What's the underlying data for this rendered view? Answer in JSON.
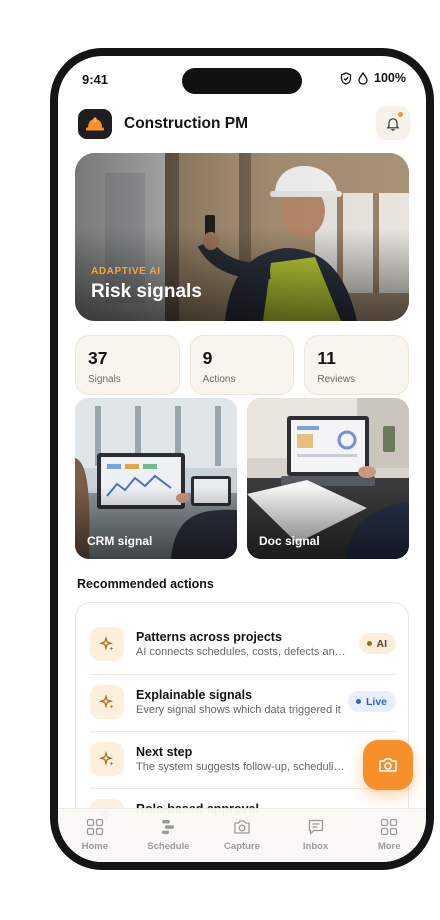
{
  "status_bar": {
    "time": "9:41",
    "battery": "100%"
  },
  "header": {
    "app_title": "Construction PM"
  },
  "hero": {
    "kicker": "ADAPTIVE AI",
    "title": "Risk signals"
  },
  "stats": [
    {
      "value": "37",
      "label": "Signals"
    },
    {
      "value": "9",
      "label": "Actions"
    },
    {
      "value": "11",
      "label": "Reviews"
    }
  ],
  "tiles": [
    {
      "label": "CRM signal"
    },
    {
      "label": "Doc signal"
    }
  ],
  "recommended": {
    "title": "Recommended actions",
    "items": [
      {
        "title": "Patterns across projects",
        "description": "AI connects schedules, costs, defects and field notes",
        "badge": "AI"
      },
      {
        "title": "Explainable signals",
        "description": "Every signal shows which data triggered it",
        "badge": "Live"
      },
      {
        "title": "Next step",
        "description": "The system suggests follow-up, scheduling and owners",
        "badge": ""
      },
      {
        "title": "Role-based approval",
        "description": "",
        "badge": ""
      }
    ]
  },
  "tabs": [
    {
      "label": "Home",
      "icon": "grid-icon"
    },
    {
      "label": "Schedule",
      "icon": "timeline-icon"
    },
    {
      "label": "Capture",
      "icon": "camera-icon"
    },
    {
      "label": "Inbox",
      "icon": "message-icon"
    },
    {
      "label": "More",
      "icon": "grid-icon"
    }
  ],
  "colors": {
    "accent": "#f7902a",
    "live_badge": "#2f63c9",
    "ai_badge_bg": "#fbefdb"
  }
}
